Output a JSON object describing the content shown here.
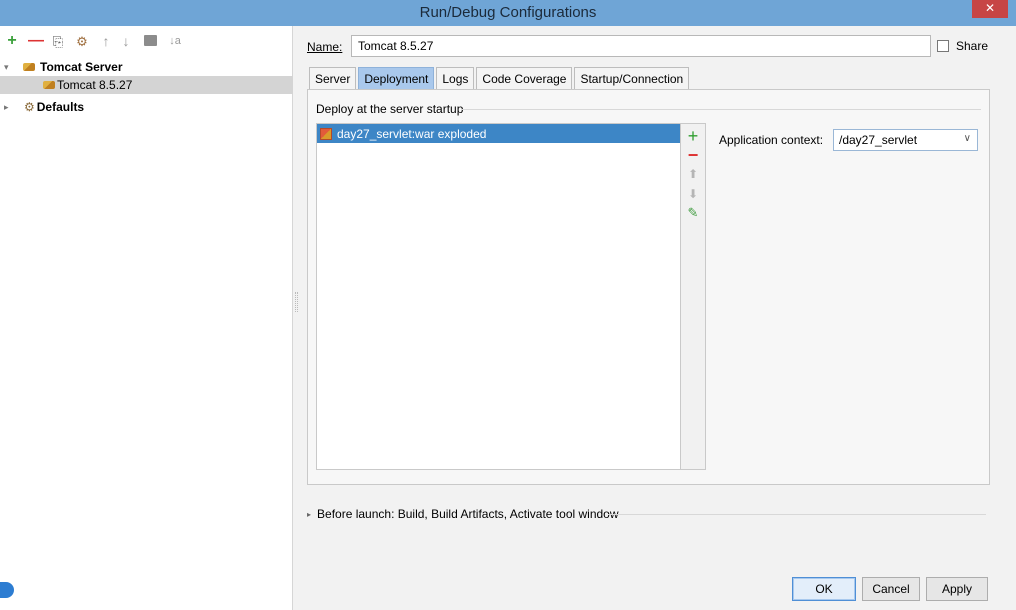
{
  "window": {
    "title": "Run/Debug Configurations",
    "close": "✕"
  },
  "toolbar": {
    "add": "+",
    "remove": "—",
    "copy": "⎘",
    "edit_defaults": "⚙",
    "move_up": "↑",
    "move_down": "↓",
    "sort": "↓a"
  },
  "tree": {
    "expand_arrow": "▾",
    "collapse_arrow": "▸",
    "group": "Tomcat Server",
    "child": "Tomcat 8.5.27",
    "defaults": "Defaults"
  },
  "form": {
    "name_label": "Name:",
    "name_value": "Tomcat 8.5.27",
    "share_label": "Share",
    "share_checked": false
  },
  "tabs": [
    {
      "label": "Server",
      "active": false
    },
    {
      "label": "Deployment",
      "active": true
    },
    {
      "label": "Logs",
      "active": false
    },
    {
      "label": "Code Coverage",
      "active": false
    },
    {
      "label": "Startup/Connection",
      "active": false
    }
  ],
  "deployment": {
    "group_title": "Deploy at the server startup",
    "items": [
      {
        "label": "day27_servlet:war exploded",
        "selected": true
      }
    ],
    "list_toolbar": {
      "add": "+",
      "remove": "−",
      "up": "⬆",
      "down": "⬇",
      "edit": "✎"
    },
    "app_context_label": "Application context:",
    "app_context_value": "/day27_servlet",
    "dropdown_chevron": "∨"
  },
  "before_launch": {
    "arrow": "▸",
    "text": "Before launch: Build, Build Artifacts, Activate tool window"
  },
  "buttons": {
    "ok": "OK",
    "cancel": "Cancel",
    "apply": "Apply"
  },
  "colors": {
    "titlebar": "#6fa5d6",
    "close": "#c74545",
    "selection": "#3d86c6",
    "active_tab": "#a9c8ec",
    "add_green": "#2f9e2f",
    "remove_red": "#dd3333"
  }
}
